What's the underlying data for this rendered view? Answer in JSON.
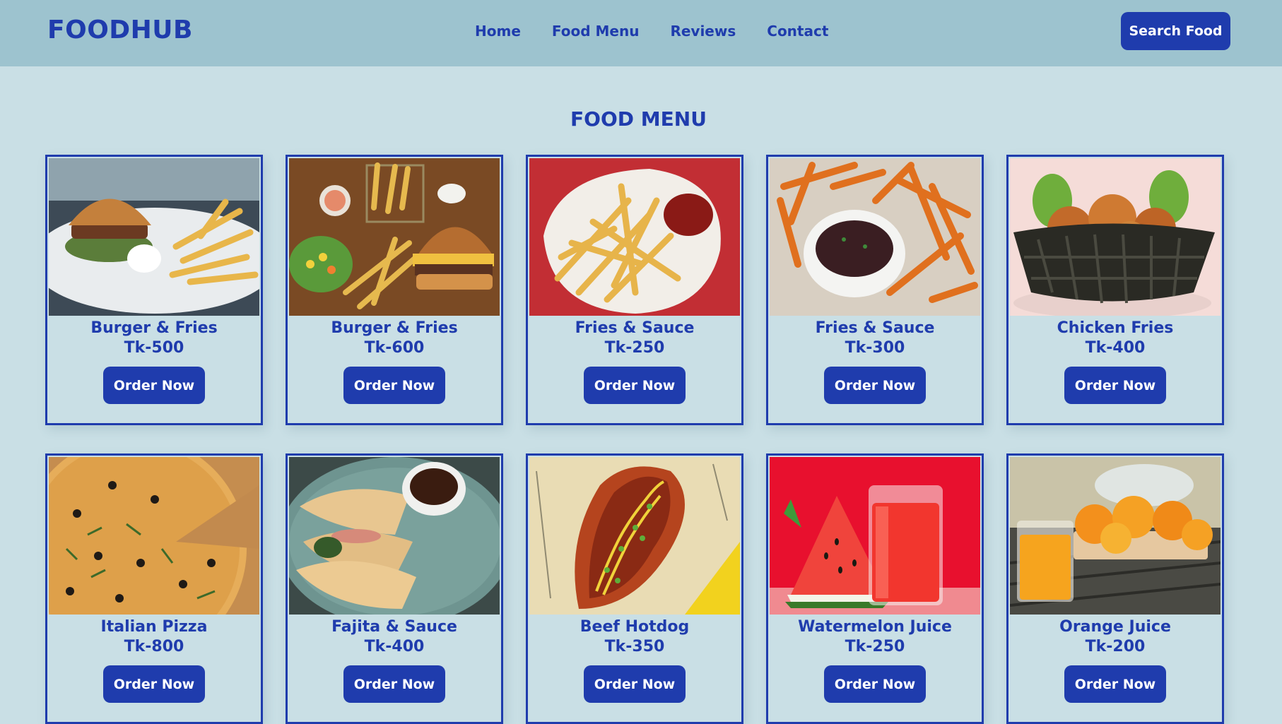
{
  "brand": "FOODHUB",
  "nav": {
    "links": [
      "Home",
      "Food Menu",
      "Reviews",
      "Contact"
    ],
    "search_label": "Search Food"
  },
  "section_title": "FOOD MENU",
  "menu": [
    {
      "name": "Burger & Fries",
      "price": "Tk-500",
      "button": "Order Now",
      "photo": "burger-fries-plate"
    },
    {
      "name": "Burger & Fries",
      "price": "Tk-600",
      "button": "Order Now",
      "photo": "burger-fries-basket"
    },
    {
      "name": "Fries & Sauce",
      "price": "Tk-250",
      "button": "Order Now",
      "photo": "fries-ketchup"
    },
    {
      "name": "Fries & Sauce",
      "price": "Tk-300",
      "button": "Order Now",
      "photo": "sweet-potato-fries"
    },
    {
      "name": "Chicken Fries",
      "price": "Tk-400",
      "button": "Order Now",
      "photo": "fried-chicken-basket"
    },
    {
      "name": "Italian Pizza",
      "price": "Tk-800",
      "button": "Order Now",
      "photo": "pizza"
    },
    {
      "name": "Fajita & Sauce",
      "price": "Tk-400",
      "button": "Order Now",
      "photo": "quesadilla"
    },
    {
      "name": "Beef Hotdog",
      "price": "Tk-350",
      "button": "Order Now",
      "photo": "hotdog"
    },
    {
      "name": "Watermelon Juice",
      "price": "Tk-250",
      "button": "Order Now",
      "photo": "watermelon-juice"
    },
    {
      "name": "Orange Juice",
      "price": "Tk-200",
      "button": "Order Now",
      "photo": "orange-juice"
    }
  ],
  "colors": {
    "primary": "#1f3cad",
    "navbar_bg": "#9dc3cf",
    "page_bg": "#c9dfe5",
    "button_text": "#ffffff"
  }
}
